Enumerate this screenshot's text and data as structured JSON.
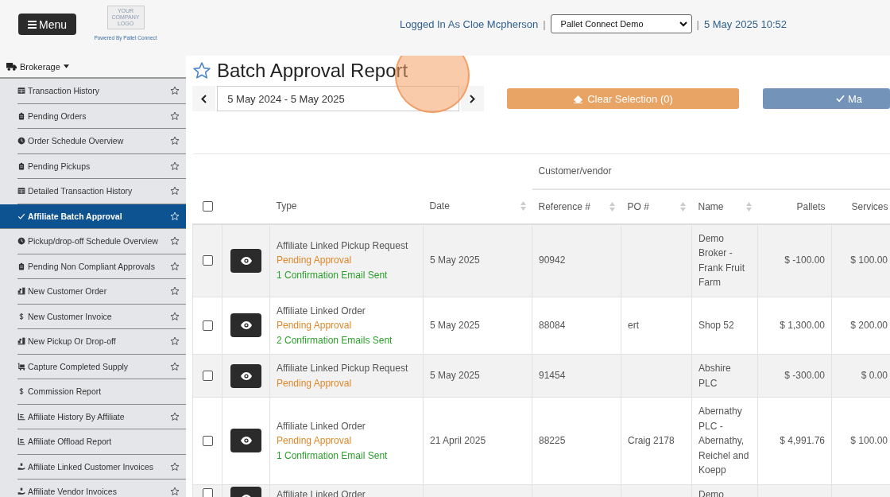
{
  "header": {
    "menu_button": "Menu",
    "logo_text": "YOUR COMPANY LOGO",
    "powered_by": "Powered By Pallet Connect",
    "logged_in": "Logged In As Cloe Mcpherson",
    "separator_1": "|",
    "company_select": "Pallet Connect Demo",
    "separator_2": "|",
    "datetime": "5 May 2025 10:52"
  },
  "sidebar": {
    "section": "Brokerage",
    "items": [
      {
        "label": "Transaction History",
        "kind": "table",
        "has_star": true,
        "selected": false
      },
      {
        "label": "Pending Orders",
        "kind": "clipboard",
        "has_star": true,
        "selected": false
      },
      {
        "label": "Order Schedule Overview",
        "kind": "clock",
        "has_star": true,
        "selected": false
      },
      {
        "label": "Pending Pickups",
        "kind": "clipboard",
        "has_star": true,
        "selected": false
      },
      {
        "label": "Detailed Transaction History",
        "kind": "table",
        "has_star": true,
        "selected": false
      },
      {
        "label": "Affiliate Batch Approval",
        "kind": "check",
        "has_star": true,
        "selected": true
      },
      {
        "label": "Pickup/drop-off Schedule Overview",
        "kind": "clock",
        "has_star": true,
        "selected": false
      },
      {
        "label": "Pending Non Compliant Approvals",
        "kind": "clipboard",
        "has_star": true,
        "selected": false
      },
      {
        "label": "New Customer Order",
        "kind": "dolly",
        "has_star": true,
        "selected": false
      },
      {
        "label": "New Customer Invoice",
        "kind": "dollar",
        "has_star": true,
        "selected": false
      },
      {
        "label": "New Pickup Or Drop-off",
        "kind": "dolly",
        "has_star": true,
        "selected": false
      },
      {
        "label": "Capture Completed Supply",
        "kind": "cart",
        "has_star": true,
        "selected": false
      },
      {
        "label": "Commission Report",
        "kind": "dollar",
        "has_star": false,
        "selected": false
      },
      {
        "label": "Affiliate History By Affiliate",
        "kind": "chart",
        "has_star": true,
        "selected": false
      },
      {
        "label": "Affiliate Offload Report",
        "kind": "chart",
        "has_star": false,
        "selected": false
      },
      {
        "label": "Affiliate Linked Customer Invoices",
        "kind": "hand",
        "has_star": true,
        "selected": false
      },
      {
        "label": "Affiliate Vendor Invoices",
        "kind": "hand",
        "has_star": true,
        "selected": false
      }
    ]
  },
  "page": {
    "title": "Batch Approval Report",
    "date_range": "5 May 2024 - 5 May 2025",
    "clear_button": "Clear Selection (0)",
    "approve_button": "Ma"
  },
  "table": {
    "group_header": "Customer/vendor",
    "select_all_checked": false,
    "columns": [
      {
        "label": "Type",
        "sortable": false
      },
      {
        "label": "Date",
        "sortable": true
      },
      {
        "label": "Reference #",
        "sortable": true
      },
      {
        "label": "PO #",
        "sortable": true
      },
      {
        "label": "Name",
        "sortable": true
      },
      {
        "label": "Pallets",
        "sortable": false
      },
      {
        "label": "Services",
        "sortable": false
      }
    ],
    "rows": [
      {
        "checked": false,
        "type": "Affiliate Linked Pickup Request",
        "status": "Pending Approval",
        "emails": "1 Confirmation Email Sent",
        "date": "5 May 2025",
        "reference": "90942",
        "po": "",
        "name": "Demo Broker - Frank Fruit Farm",
        "pallets": "$ -100.00",
        "services": "$ 100.00"
      },
      {
        "checked": false,
        "type": "Affiliate Linked Order",
        "status": "Pending Approval",
        "emails": "2 Confirmation Emails Sent",
        "date": "5 May 2025",
        "reference": "88084",
        "po": "ert",
        "name": "Shop 52",
        "pallets": "$ 1,300.00",
        "services": "$ 200.00"
      },
      {
        "checked": false,
        "type": "Affiliate Linked Pickup Request",
        "status": "Pending Approval",
        "date": "5 May 2025",
        "reference": "91454",
        "po": "",
        "name": "Abshire PLC",
        "pallets": "$ -300.00",
        "services": "$ 0.00"
      },
      {
        "checked": false,
        "type": "Affiliate Linked Order",
        "status": "Pending Approval",
        "emails": "1 Confirmation Email Sent",
        "date": "21 April 2025",
        "reference": "88225",
        "po": "Craig 2178",
        "name": "Abernathy PLC - Abernathy, Reichel and Koepp",
        "pallets": "$ 4,991.76",
        "services": "$ 100.00"
      },
      {
        "checked": false,
        "type": "Affiliate Linked Order",
        "date": "",
        "reference": "",
        "po": "",
        "name": "Demo",
        "pallets": "",
        "services": ""
      }
    ]
  }
}
